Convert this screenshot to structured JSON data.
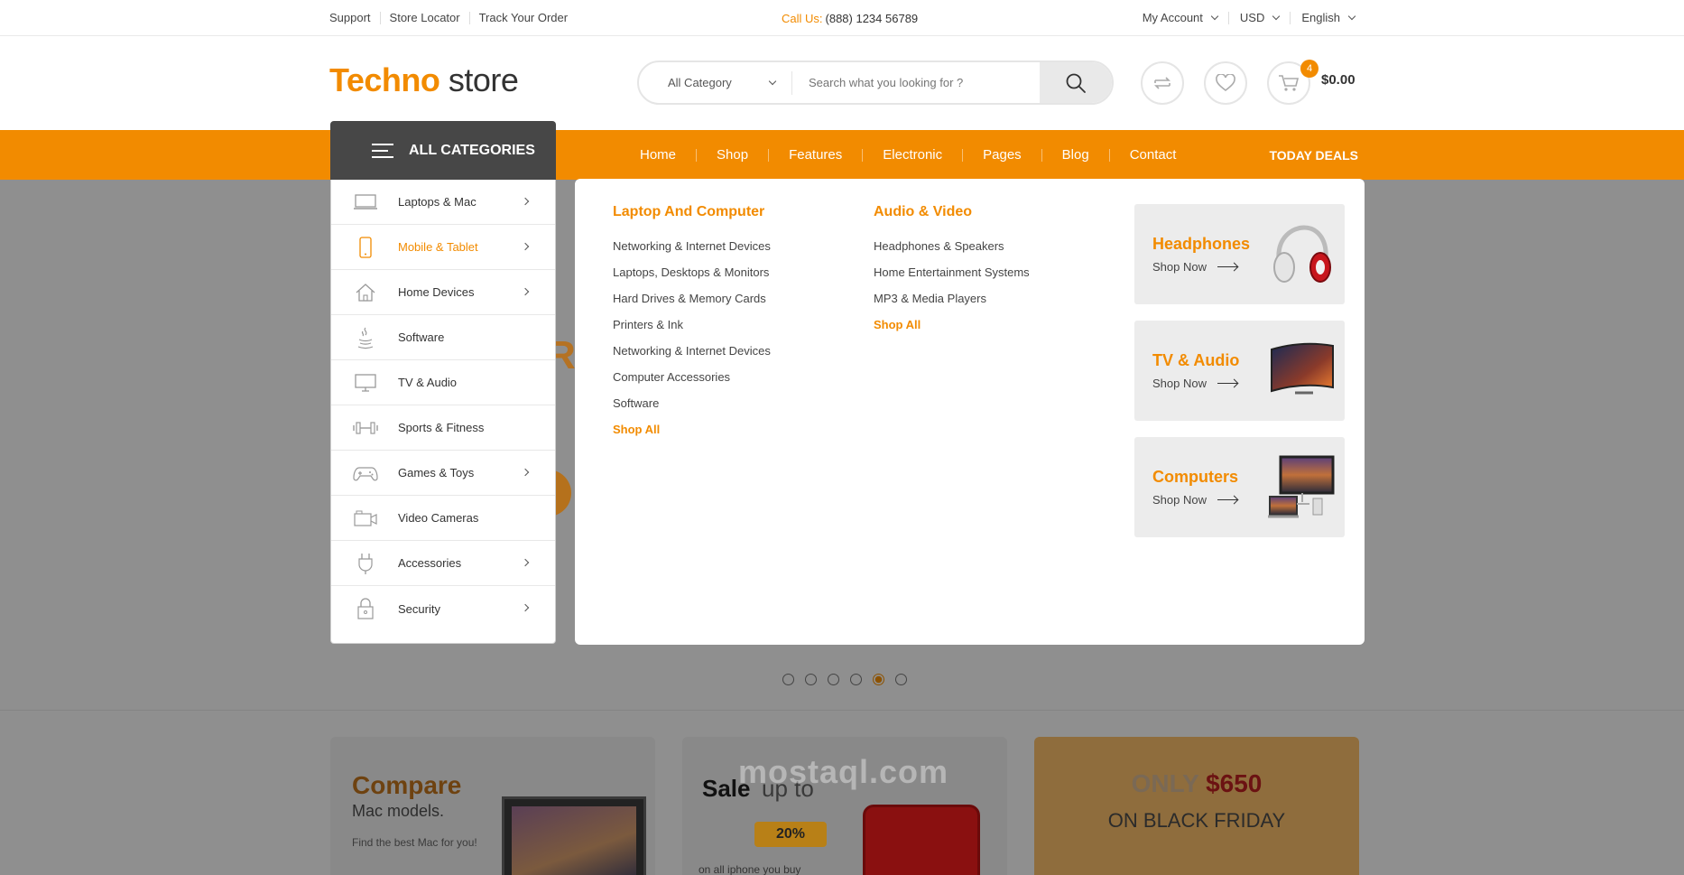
{
  "topbar": {
    "links": [
      "Support",
      "Store Locator",
      "Track Your Order"
    ],
    "call_label": "Call Us:",
    "call_number": "(888) 1234 56789",
    "account": "My Account",
    "currency": "USD",
    "language": "English"
  },
  "header": {
    "logo_a": "Techno",
    "logo_b": "store",
    "search_category": "All Category",
    "search_placeholder": "Search what you looking for ?",
    "cart_count": "4",
    "cart_total": "$0.00"
  },
  "nav": {
    "all_categories": "ALL CATEGORIES",
    "items": [
      "Home",
      "Shop",
      "Features",
      "Electronic",
      "Pages",
      "Blog",
      "Contact"
    ],
    "deals": "TODAY DEALS"
  },
  "categories": [
    {
      "label": "Laptops & Mac",
      "icon": "laptop-icon",
      "submenu": true
    },
    {
      "label": "Mobile & Tablet",
      "icon": "mobile-icon",
      "submenu": true,
      "active": true
    },
    {
      "label": "Home Devices",
      "icon": "home-icon",
      "submenu": true
    },
    {
      "label": "Software",
      "icon": "java-icon",
      "submenu": false
    },
    {
      "label": "TV & Audio",
      "icon": "monitor-icon",
      "submenu": false
    },
    {
      "label": "Sports & Fitness",
      "icon": "dumbbell-icon",
      "submenu": false
    },
    {
      "label": "Games & Toys",
      "icon": "gamepad-icon",
      "submenu": true
    },
    {
      "label": "Video Cameras",
      "icon": "camera-icon",
      "submenu": false
    },
    {
      "label": "Accessories",
      "icon": "plug-icon",
      "submenu": true
    },
    {
      "label": "Security",
      "icon": "lock-icon",
      "submenu": true
    }
  ],
  "mega": {
    "col1": {
      "title": "Laptop And Computer",
      "items": [
        "Networking & Internet Devices",
        "Laptops, Desktops & Monitors",
        "Hard Drives & Memory Cards",
        "Printers & Ink",
        "Networking & Internet Devices",
        "Computer Accessories",
        "Software"
      ],
      "more": "Shop All"
    },
    "col2": {
      "title": "Audio & Video",
      "items": [
        "Headphones & Speakers",
        "Home Entertainment Systems",
        "MP3 & Media Players"
      ],
      "more": "Shop All"
    },
    "cards": [
      {
        "title": "Headphones",
        "cta": "Shop Now"
      },
      {
        "title": "TV & Audio",
        "cta": "Shop Now"
      },
      {
        "title": "Computers",
        "cta": "Shop Now"
      }
    ]
  },
  "promos": {
    "compare_title": "Compare",
    "compare_sub": "Mac models.",
    "compare_desc": "Find the best Mac for you!",
    "sale_title": "Sale",
    "sale_rest": "up to",
    "sale_badge": "20%",
    "sale_desc": "on all iphone you buy",
    "only_label": "ONLY",
    "only_price": "$650",
    "only_sub": "ON BLACK FRIDAY"
  },
  "slider": {
    "count": 6,
    "active": 5
  },
  "watermark": "mostaql.com",
  "colors": {
    "accent": "#f28b00",
    "dark": "#474747"
  }
}
